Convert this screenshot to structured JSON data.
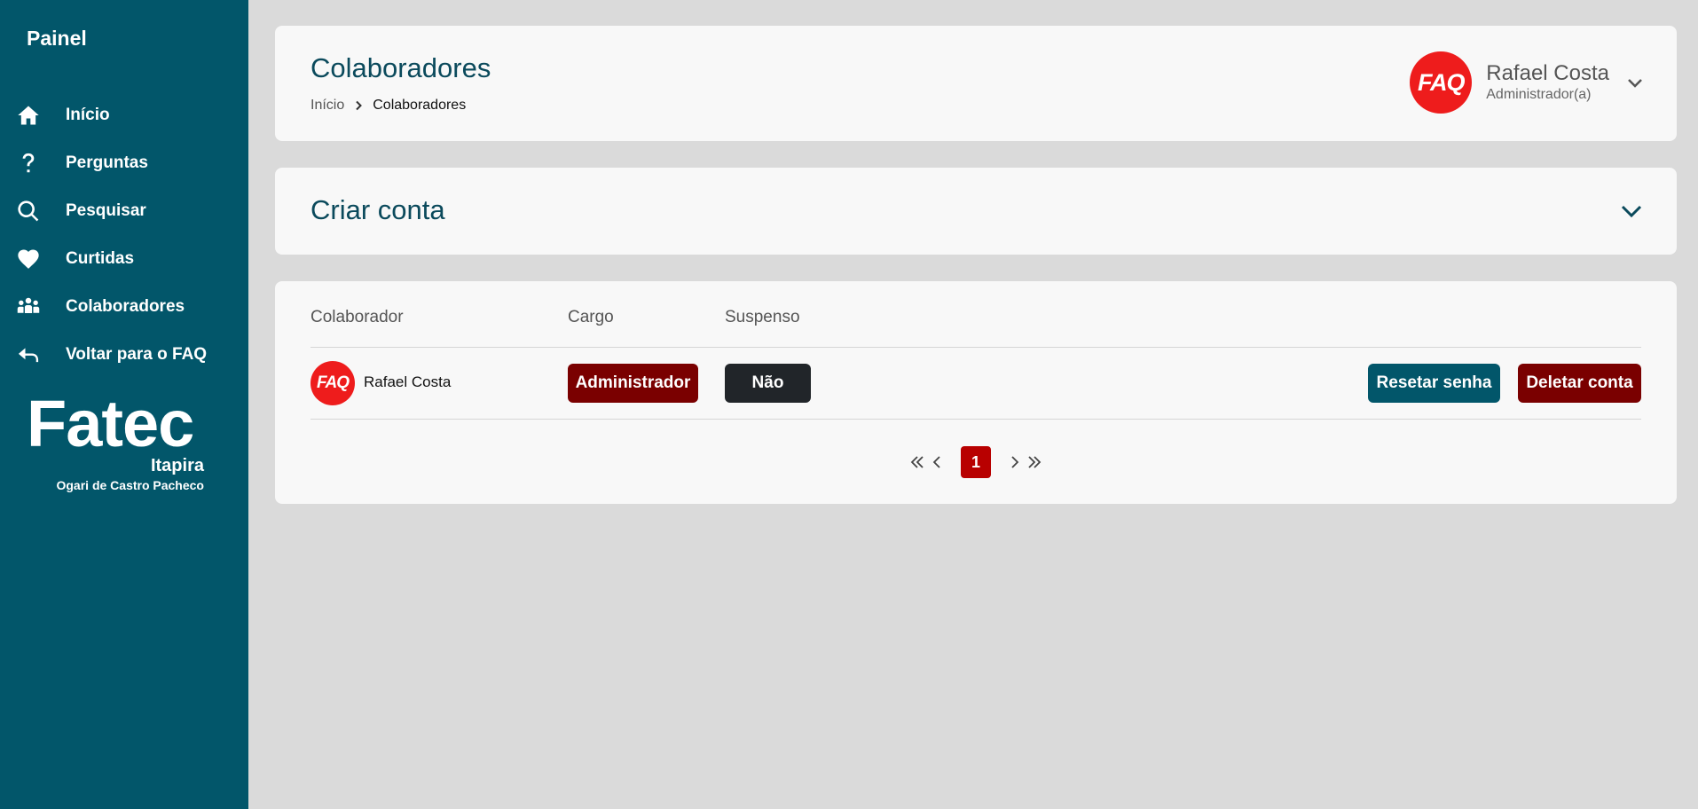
{
  "sidebar": {
    "title": "Painel",
    "items": [
      {
        "label": "Início",
        "icon": "home-icon"
      },
      {
        "label": "Perguntas",
        "icon": "question-icon"
      },
      {
        "label": "Pesquisar",
        "icon": "search-icon"
      },
      {
        "label": "Curtidas",
        "icon": "heart-icon"
      },
      {
        "label": "Colaboradores",
        "icon": "users-icon"
      },
      {
        "label": "Voltar para o FAQ",
        "icon": "reply-icon"
      }
    ],
    "brand": {
      "name": "Fatec",
      "city": "Itapira",
      "subtitle": "Ogari de Castro Pacheco"
    }
  },
  "header": {
    "title": "Colaboradores",
    "breadcrumb": {
      "home": "Início",
      "current": "Colaboradores"
    },
    "user": {
      "avatar_text": "FAQ",
      "name": "Rafael Costa",
      "role": "Administrador(a)"
    }
  },
  "create": {
    "title": "Criar conta"
  },
  "table": {
    "columns": [
      "Colaborador",
      "Cargo",
      "Suspenso"
    ],
    "rows": [
      {
        "avatar_text": "FAQ",
        "name": "Rafael Costa",
        "role": "Administrador",
        "suspended": "Não",
        "reset_label": "Resetar senha",
        "delete_label": "Deletar conta"
      }
    ]
  },
  "pagination": {
    "current_page": "1"
  },
  "colors": {
    "sidebar": "#02566a",
    "accent_red": "#7a0000",
    "avatar_red": "#ee1c1c",
    "page_active": "#b80000",
    "dark_badge": "#212529"
  }
}
